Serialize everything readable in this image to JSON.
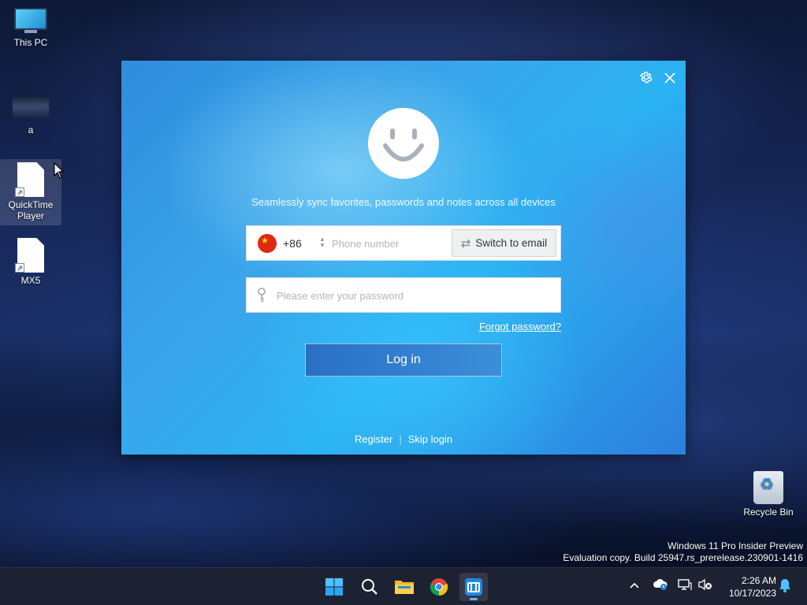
{
  "desktop": {
    "icons": [
      {
        "label": "This PC"
      },
      {
        "label": "a"
      },
      {
        "label": "QuickTime Player"
      },
      {
        "label": "MX5"
      },
      {
        "label": "Recycle Bin"
      }
    ],
    "watermark": {
      "line1": "Windows 11 Pro Insider Preview",
      "line2": "Evaluation copy. Build 25947.rs_prerelease.230901-1416"
    }
  },
  "dialog": {
    "settings_icon": "gear-icon",
    "close_icon": "close-icon",
    "tagline": "Seamlessly sync favorites, passwords and notes across all devices",
    "phone": {
      "country_code": "+86",
      "placeholder": "Phone number",
      "switch_label": "Switch to email"
    },
    "password": {
      "placeholder": "Please enter your password"
    },
    "forgot_label": "Forgot password?",
    "login_label": "Log in",
    "register_label": "Register",
    "skip_label": "Skip login"
  },
  "taskbar": {
    "icons": [
      "start-icon",
      "search-icon",
      "file-explorer-icon",
      "chrome-icon",
      "maxthon-icon"
    ],
    "tray": [
      "chevron-up-icon",
      "cloud-icon",
      "network-icon",
      "volume-muted-icon",
      "notification-bell-icon"
    ],
    "time": "2:26 AM",
    "date": "10/17/2023"
  },
  "colors": {
    "accent": "#3aa5ea",
    "taskbar": "#1d2233",
    "login_button": "#2a6fc4"
  }
}
